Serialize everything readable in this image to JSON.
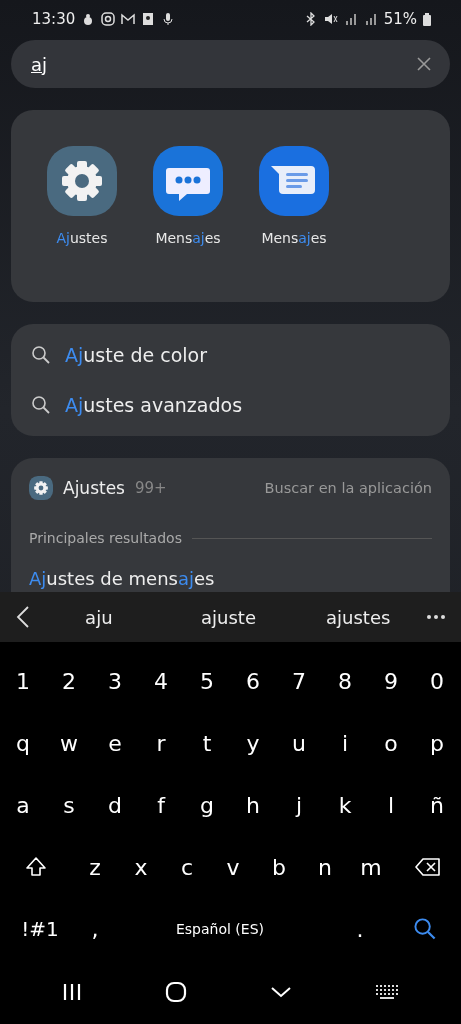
{
  "status_bar": {
    "time": "13:30",
    "battery": "51%"
  },
  "search": {
    "value": "aj"
  },
  "apps": [
    {
      "kind": "settings",
      "label": {
        "match": "Aj",
        "after": "ustes"
      }
    },
    {
      "kind": "chat",
      "label": {
        "before": "Mens",
        "match": "aj",
        "after": "es"
      }
    },
    {
      "kind": "messages",
      "label": {
        "before": "Mens",
        "match": "aj",
        "after": "es"
      }
    }
  ],
  "suggestions": [
    {
      "match": "Aj",
      "after": "uste de color"
    },
    {
      "match": "Aj",
      "after": "ustes avanzados"
    }
  ],
  "app_results": {
    "app": "Ajustes",
    "count": "99+",
    "action": "Buscar en la aplicación",
    "section": "Principales resultados",
    "results": [
      {
        "match": "Aj",
        "after": "ustes de mens",
        "match2": "aj",
        "after2": "es"
      }
    ]
  },
  "keyboard": {
    "predictions": [
      "aju",
      "ajuste",
      "ajustes"
    ],
    "rows": [
      [
        "1",
        "2",
        "3",
        "4",
        "5",
        "6",
        "7",
        "8",
        "9",
        "0"
      ],
      [
        "q",
        "w",
        "e",
        "r",
        "t",
        "y",
        "u",
        "i",
        "o",
        "p"
      ],
      [
        "a",
        "s",
        "d",
        "f",
        "g",
        "h",
        "j",
        "k",
        "l",
        "ñ"
      ],
      [
        "z",
        "x",
        "c",
        "v",
        "b",
        "n",
        "m"
      ]
    ],
    "symbols": "!#1",
    "comma": ",",
    "space": "Español (ES)",
    "period": "."
  }
}
